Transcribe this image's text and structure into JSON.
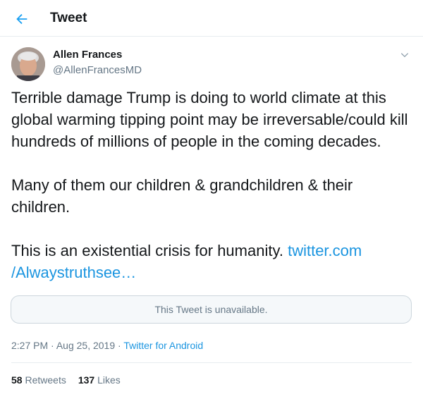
{
  "header": {
    "title": "Tweet",
    "back_icon": "arrow-left-icon",
    "accent": "#1da1f2"
  },
  "author": {
    "name": "Allen Frances",
    "handle": "@AllenFrancesMD"
  },
  "tweet": {
    "paragraph1": "Terrible damage Trump is doing to world climate at this global warming tipping point may be irreversable/could kill hundreds of millions of people in the coming decades.",
    "paragraph2": "Many of them our children & grandchildren & their children.",
    "paragraph3": "This is an existential crisis for humanity.",
    "link_line1": "twitter.com",
    "link_line2": "/Alwaystruthsee…"
  },
  "quoted": {
    "text": "This Tweet is unavailable."
  },
  "meta": {
    "time": "2:27 PM",
    "separator": "·",
    "date": "Aug 25, 2019",
    "source": "Twitter for Android"
  },
  "stats": {
    "retweets_count": "58",
    "retweets_label": "Retweets",
    "likes_count": "137",
    "likes_label": "Likes"
  }
}
